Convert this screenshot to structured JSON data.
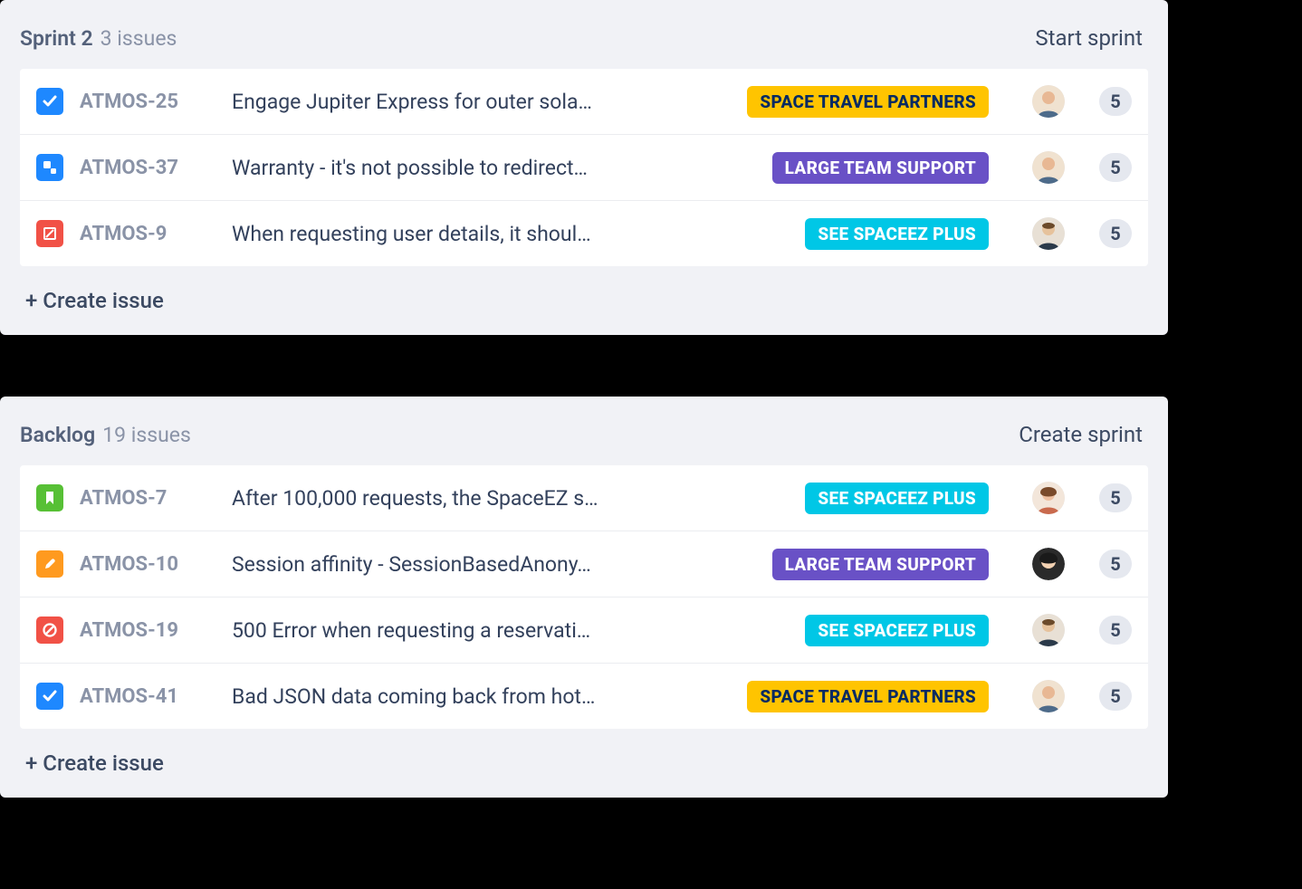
{
  "create_issue_label": "+ Create issue",
  "sections": [
    {
      "title": "Sprint 2",
      "count_label": "3 issues",
      "action_label": "Start sprint",
      "issues": [
        {
          "icon": "check",
          "icon_color": "blue",
          "key": "ATMOS-25",
          "summary": "Engage Jupiter Express for outer sola…",
          "epic": "SPACE TRAVEL PARTNERS",
          "epic_color": "yellow",
          "avatar": "a1",
          "points": "5"
        },
        {
          "icon": "subtask",
          "icon_color": "blue",
          "key": "ATMOS-37",
          "summary": "Warranty - it's not possible to redirect…",
          "epic": "LARGE TEAM SUPPORT",
          "epic_color": "purple",
          "avatar": "a1",
          "points": "5"
        },
        {
          "icon": "blocked",
          "icon_color": "red",
          "key": "ATMOS-9",
          "summary": "When requesting user details, it shoul…",
          "epic": "SEE SPACEEZ PLUS",
          "epic_color": "teal",
          "avatar": "a2",
          "points": "5"
        }
      ]
    },
    {
      "title": "Backlog",
      "count_label": "19 issues",
      "action_label": "Create sprint",
      "issues": [
        {
          "icon": "bookmark",
          "icon_color": "green",
          "key": "ATMOS-7",
          "summary": "After 100,000 requests, the SpaceEZ s…",
          "epic": "SEE SPACEEZ PLUS",
          "epic_color": "teal",
          "avatar": "a3",
          "points": "5"
        },
        {
          "icon": "wrench",
          "icon_color": "orange",
          "key": "ATMOS-10",
          "summary": "Session affinity - SessionBasedAnony…",
          "epic": "LARGE TEAM SUPPORT",
          "epic_color": "purple",
          "avatar": "a4",
          "points": "5"
        },
        {
          "icon": "no",
          "icon_color": "red",
          "key": "ATMOS-19",
          "summary": "500 Error when requesting a reservati…",
          "epic": "SEE SPACEEZ PLUS",
          "epic_color": "teal",
          "avatar": "a2",
          "points": "5"
        },
        {
          "icon": "check",
          "icon_color": "blue",
          "key": "ATMOS-41",
          "summary": "Bad JSON data coming back from hot…",
          "epic": "SPACE TRAVEL PARTNERS",
          "epic_color": "yellow",
          "avatar": "a1",
          "points": "5"
        }
      ]
    }
  ]
}
